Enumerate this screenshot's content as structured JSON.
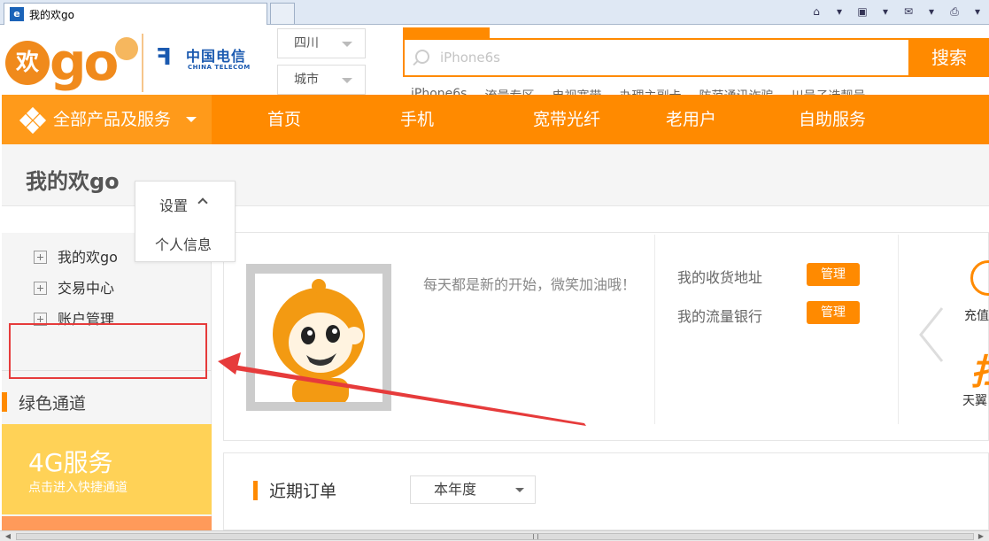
{
  "browser": {
    "tab_title": "我的欢go"
  },
  "header": {
    "logo_huan": "欢",
    "logo_go": "go",
    "telecom_cn": "中国电信",
    "telecom_en": "CHINA TELECOM",
    "province": "四川",
    "city": "城市",
    "search_placeholder": "iPhone6s",
    "search_button": "搜索",
    "hot_links": [
      "iPhone6s",
      "流量专区",
      "电视宽带",
      "办理主副卡",
      "防范通讯诈骗",
      "川号子选靓号"
    ]
  },
  "nav": {
    "all_label": "全部产品及服务",
    "items": [
      "首页",
      "手机",
      "宽带光纤",
      "老用户",
      "自助服务"
    ]
  },
  "sidebar": {
    "page_title": "我的欢go",
    "menu": [
      "我的欢go",
      "交易中心",
      "账户管理"
    ],
    "green_channel": "绿色通道",
    "promo_title": "4G服务",
    "promo_sub": "点击进入快捷通道"
  },
  "settings_dropdown": {
    "label": "设置",
    "option": "个人信息"
  },
  "profile": {
    "motto": "每天都是新的开始，微笑加油哦！",
    "address_label": "我的收货地址",
    "flow_label": "我的流量银行",
    "manage_label": "管理",
    "recharge": "充值",
    "tianyi": "天翼"
  },
  "orders": {
    "title": "近期订单",
    "period": "本年度"
  },
  "colors": {
    "brand_orange": "#ff8a00",
    "annotation_red": "#e63b3b"
  }
}
